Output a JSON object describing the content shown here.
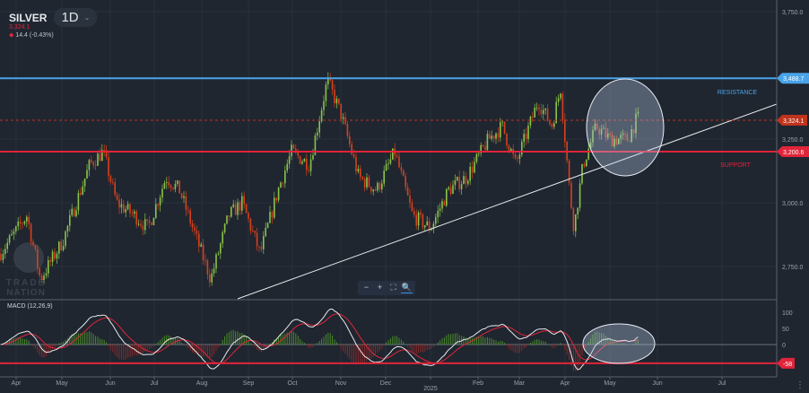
{
  "header": {
    "symbol": "SILVER",
    "timeframe": "1D",
    "last_price": "3,324.1",
    "change": "14.4 (-0.43%)"
  },
  "price_axis": {
    "ticks": [
      {
        "v": 3750,
        "label": "3,750.0"
      },
      {
        "v": 3250,
        "label": "3,250.0"
      },
      {
        "v": 3000,
        "label": "3,000.0"
      },
      {
        "v": 2750,
        "label": "2,750.0"
      }
    ],
    "resistance": {
      "value": 3488.7,
      "label": "3,488.7",
      "text": "RESISTANCE",
      "color": "#4aa3e8"
    },
    "support": {
      "value": 3200.6,
      "label": "3,200.6",
      "text": "SUPPORT",
      "color": "#e0243a"
    },
    "current": {
      "value": 3324.1,
      "label": "3,324.1",
      "color": "#c0331c"
    }
  },
  "macd": {
    "label": "MACD (12,26,9)",
    "ticks": [
      {
        "v": 100,
        "label": "100"
      },
      {
        "v": 50,
        "label": "50"
      },
      {
        "v": 0,
        "label": "0"
      }
    ],
    "level": {
      "value": -58,
      "label": "-58"
    }
  },
  "time_axis": [
    "Apr",
    "May",
    "Jun",
    "Jul",
    "Aug",
    "Sep",
    "Oct",
    "Nov",
    "Dec",
    "2025",
    "Feb",
    "Mar",
    "Apr",
    "May",
    "Jun",
    "Jul"
  ],
  "zoom_controls": [
    "−",
    "+",
    "⛶",
    "🔍"
  ],
  "logo": {
    "text": "TRADE NATION"
  },
  "chart_data": {
    "type": "candlestick",
    "price_path": [
      [
        0,
        2800
      ],
      [
        30,
        2950
      ],
      [
        45,
        2700
      ],
      [
        70,
        2850
      ],
      [
        100,
        3150
      ],
      [
        115,
        3200
      ],
      [
        130,
        3000
      ],
      [
        150,
        2950
      ],
      [
        165,
        2900
      ],
      [
        185,
        3100
      ],
      [
        200,
        3050
      ],
      [
        215,
        2900
      ],
      [
        235,
        2700
      ],
      [
        255,
        2950
      ],
      [
        270,
        3000
      ],
      [
        290,
        2800
      ],
      [
        310,
        3050
      ],
      [
        325,
        3200
      ],
      [
        345,
        3150
      ],
      [
        365,
        3480
      ],
      [
        380,
        3350
      ],
      [
        400,
        3100
      ],
      [
        420,
        3050
      ],
      [
        440,
        3200
      ],
      [
        460,
        2950
      ],
      [
        480,
        2900
      ],
      [
        500,
        3050
      ],
      [
        520,
        3100
      ],
      [
        545,
        3250
      ],
      [
        560,
        3300
      ],
      [
        575,
        3150
      ],
      [
        600,
        3400
      ],
      [
        615,
        3300
      ],
      [
        625,
        3450
      ],
      [
        635,
        3050
      ],
      [
        640,
        2900
      ],
      [
        650,
        3150
      ],
      [
        665,
        3300
      ],
      [
        680,
        3250
      ],
      [
        700,
        3250
      ],
      [
        710,
        3330
      ]
    ],
    "colors": {
      "up": "#8bc34a",
      "down": "#d8401c",
      "macd": "#e8e8e8",
      "signal": "#e0243a"
    }
  }
}
